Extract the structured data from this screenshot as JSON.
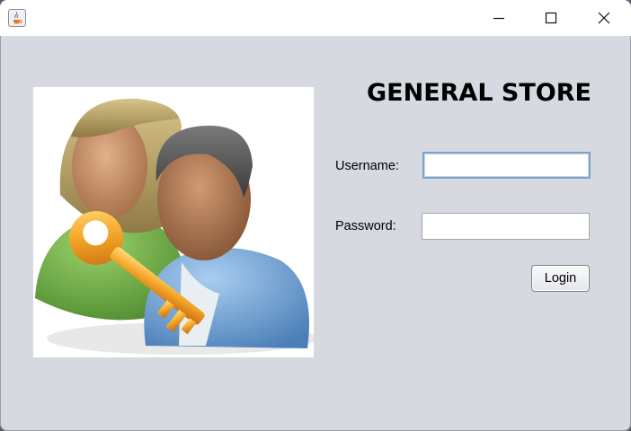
{
  "window": {
    "title": "",
    "icon": "java-cup-icon",
    "controls": [
      "minimize-icon",
      "maximize-icon",
      "close-icon"
    ]
  },
  "image": {
    "icon": "users-key-icon"
  },
  "form": {
    "heading": "GENERAL STORE",
    "username_label": "Username:",
    "username_value": "",
    "password_label": "Password:",
    "password_value": "",
    "login_label": "Login"
  },
  "colors": {
    "window_background": "#d6d9e0",
    "titlebar": "#ffffff",
    "focus_border": "#7ea3c9"
  }
}
